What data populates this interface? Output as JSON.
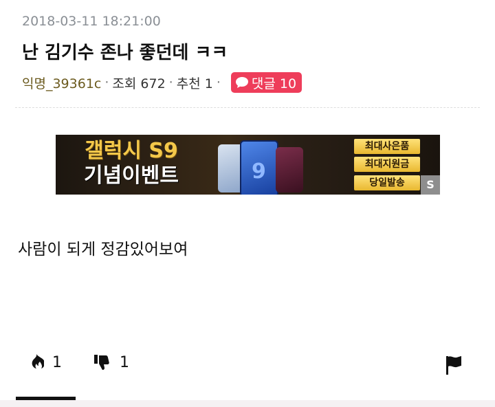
{
  "post": {
    "timestamp": "2018-03-11 18:21:00",
    "title": "난 김기수 존나 좋던데 ㅋㅋ",
    "author": "익명_39361c",
    "views_label": "조회 672",
    "recommend_label": "추천 1",
    "separator": "·",
    "comments_label": "댓글 10",
    "body": "사람이 되게 정감있어보여"
  },
  "ad": {
    "headline_1": "갤럭시 S9",
    "headline_2": "기념이벤트",
    "phone_glyph": "9",
    "buttons": [
      "최대사은품",
      "최대지원금",
      "당일발송"
    ],
    "corner_label": "S"
  },
  "actions": {
    "like_count": "1",
    "dislike_count": "1"
  },
  "colors": {
    "comment_badge": "#ee3d5a",
    "author": "#6b5a1e",
    "timestamp": "#8a8f95"
  },
  "icons": {
    "comment": "speech-bubble-icon",
    "like": "fire-icon",
    "dislike": "thumbs-down-icon",
    "report": "flag-icon"
  }
}
